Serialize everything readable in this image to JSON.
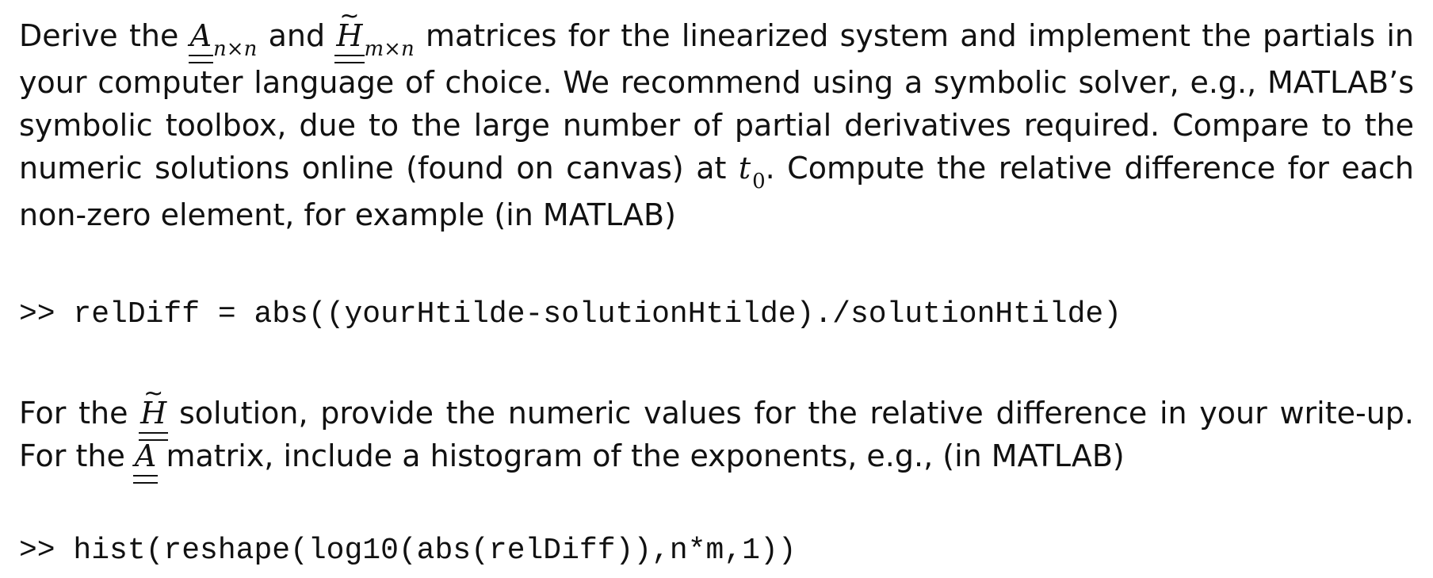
{
  "paragraph1": {
    "t1": "Derive the ",
    "A_symbol": "A",
    "A_sub": "n×n",
    "t2": " and ",
    "H_symbol": "H",
    "H_tilde": "~",
    "H_sub": "m×n",
    "t3": " matrices for the linearized system and implement the partials in your computer language of choice. We recommend using a symbolic solver, e.g., MATLAB’s symbolic toolbox, due to the large number of partial derivatives required. Compare to the numeric solutions online (found on canvas) at ",
    "t0_symbol": "t",
    "t0_sub": "0",
    "t4": ". Compute the relative difference for each non-zero element, for example (in MATLAB)"
  },
  "code1": ">> relDiff = abs((yourHtilde-solutionHtilde)./solutionHtilde)",
  "paragraph2": {
    "t1": "For the ",
    "H_symbol": "H",
    "H_tilde": "~",
    "t2": " solution, provide the numeric values for the relative difference in your write-up. For the ",
    "A_symbol": "A",
    "t3": " matrix, include a histogram of the exponents, e.g., (in MATLAB)"
  },
  "code2": ">> hist(reshape(log10(abs(relDiff)),n*m,1))"
}
